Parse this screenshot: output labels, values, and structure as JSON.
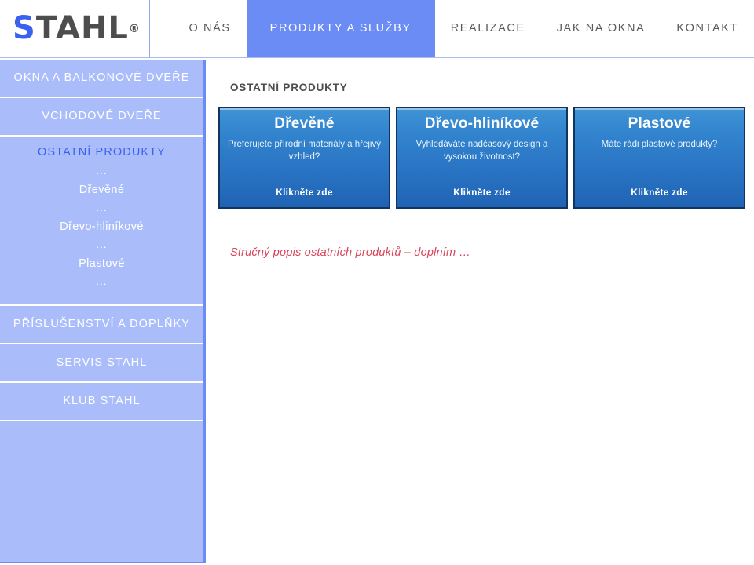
{
  "header": {
    "logo": {
      "first_letter": "S",
      "rest": "TAHL",
      "trademark": "®",
      "icon": "stahl-logo"
    },
    "nav": [
      {
        "label": "O NÁS",
        "active": false
      },
      {
        "label": "PRODUKTY A SLUŽBY",
        "active": true
      },
      {
        "label": "REALIZACE",
        "active": false
      },
      {
        "label": "JAK NA OKNA",
        "active": false
      },
      {
        "label": "KONTAKT",
        "active": false
      }
    ]
  },
  "sidebar": {
    "items": [
      {
        "label": "OKNA A BALKONOVÉ DVEŘE"
      },
      {
        "label": "VCHODOVÉ DVEŘE"
      }
    ],
    "expanded_section": {
      "title": "OSTATNÍ PRODUKTY",
      "dots": "...",
      "subitems": [
        {
          "label": "Dřevěné"
        },
        {
          "label": "Dřevo-hliníkové"
        },
        {
          "label": "Plastové"
        }
      ]
    },
    "items_after": [
      {
        "label": "PŘÍSLUŠENSTVÍ A DOPLŇKY"
      },
      {
        "label": "SERVIS STAHL"
      },
      {
        "label": "KLUB STAHL"
      }
    ]
  },
  "main": {
    "title": "OSTATNÍ PRODUKTY",
    "cards": [
      {
        "title": "Dřevěné",
        "description": "Preferujete přírodní materiály a hřejivý vzhled?",
        "link": "Klikněte zde"
      },
      {
        "title": "Dřevo-hliníkové",
        "description": "Vyhledáváte nadčasový design a  vysokou životnost?",
        "link": "Klikněte zde"
      },
      {
        "title": "Plastové",
        "description": "Máte rádi plastové produkty?",
        "link": "Klikněte zde"
      }
    ],
    "note": "Stručný popis ostatních produktů – doplním …"
  },
  "colors": {
    "nav_active_bg": "#6b8bf5",
    "sidebar_bg": "#aabdfa",
    "sidebar_border": "#6b8bf5",
    "sidebar_active_text": "#3a62f0",
    "card_gradient_top": "#3f93d6",
    "card_gradient_bottom": "#2063b4",
    "card_border": "#11355f",
    "note_text": "#d9435a",
    "logo_blue": "#3a62f0",
    "logo_gray": "#4d4d4d"
  }
}
